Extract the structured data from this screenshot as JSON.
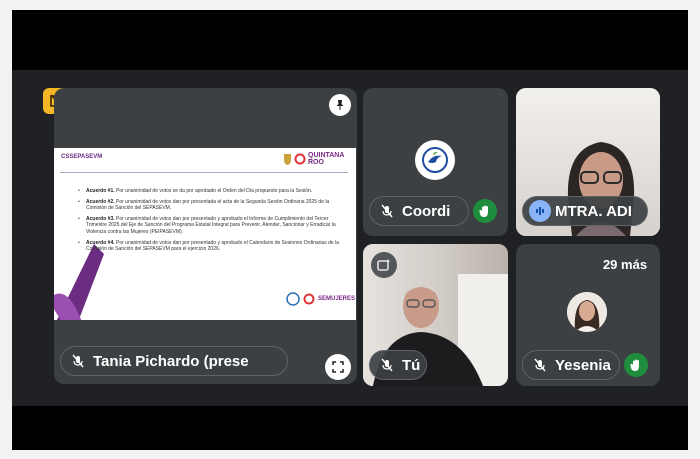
{
  "presentation": {
    "presenter_label": "Tania Pichardo (prese",
    "slide": {
      "header_tag": "CSSEPASEVM",
      "logo_text": "QUINTANA ROO",
      "footer_logo_text": "SEMUJERES",
      "items": [
        {
          "title": "Acuerdo #1.",
          "text": " Por unanimidad de votos se da por aprobado el Orden del Día propuesto para la Sesión."
        },
        {
          "title": "Acuerdo #2.",
          "text": " Por unanimidad de votos dan por presentada el acta de la Segunda Sesión Ordinaria 2025 de la Comisión de Sanción del SEPASEVM."
        },
        {
          "title": "Acuerdo #3.",
          "text": " Por unanimidad de votos dan por presentado y aprobado el Informe de Cumplimiento del Tercer Trimestre 2025 del Eje de Sanción del Programa Estatal Integral para Prevenir, Atender, Sancionar y Erradicar la Violencia contra las Mujeres (PEIPASEVM)."
        },
        {
          "title": "Acuerdo #4.",
          "text": " Por unanimidad de votos dan por presentado y aprobado el Calendario de Sesiones Ordinarias de la Comisión de Sanción del SEPASEVM para el ejercicio 2026."
        }
      ]
    }
  },
  "participants": [
    {
      "id": "coordinacion",
      "label": "Coordi"
    },
    {
      "id": "mtra",
      "label": "MTRA. ADI"
    },
    {
      "id": "self",
      "label": "Tú"
    },
    {
      "id": "yesenia",
      "label": "Yesenia"
    }
  ],
  "more_participants": "29 más",
  "colors": {
    "accent": "#f3b625",
    "hand": "#1e8e3e",
    "tile": "#3c4043",
    "stage": "#202124"
  }
}
